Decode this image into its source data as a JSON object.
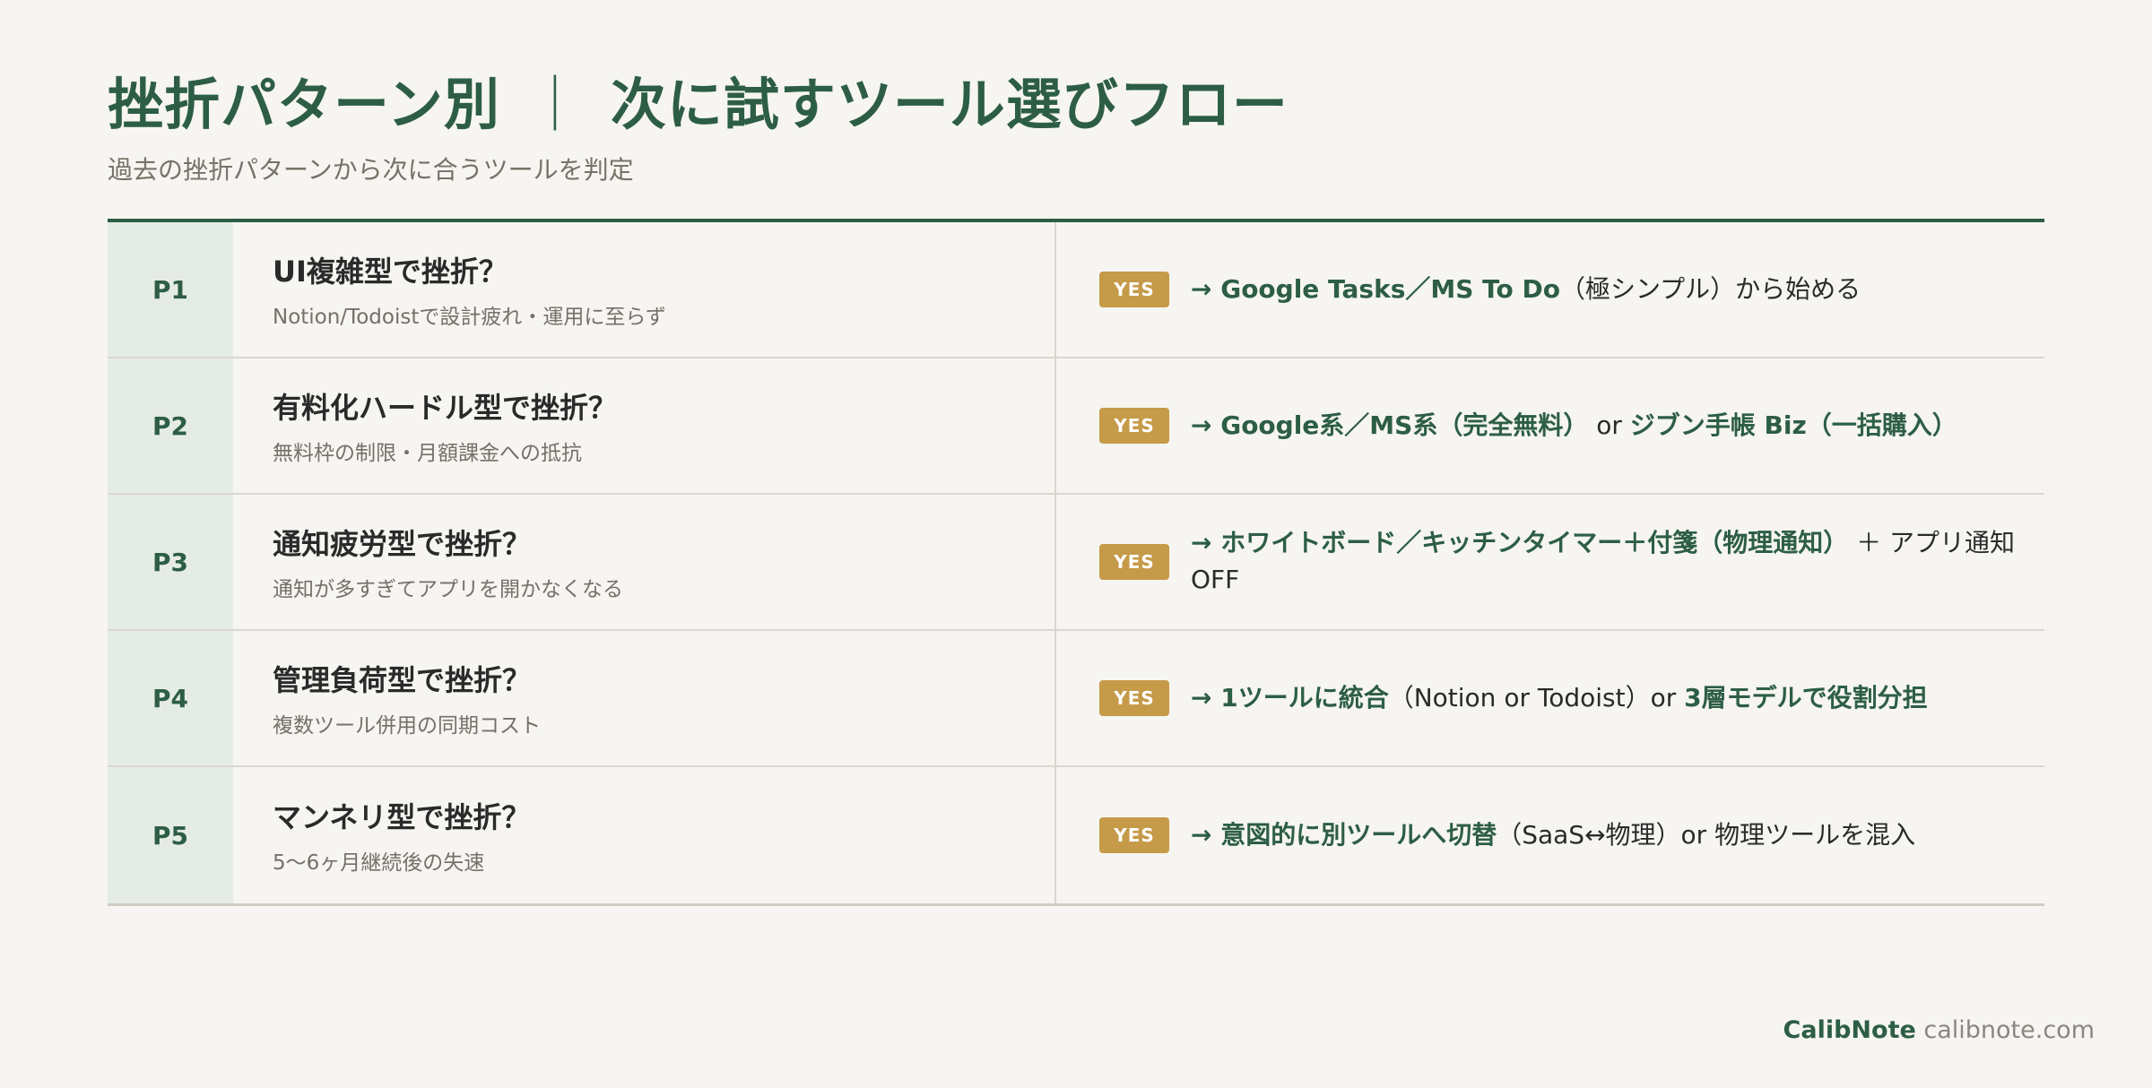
{
  "header": {
    "title_left": "挫折パターン別",
    "title_separator": "｜",
    "title_right": "次に試すツール選びフロー",
    "subtitle": "過去の挫折パターンから次に合うツールを判定"
  },
  "badge_label": "YES",
  "rows": [
    {
      "code": "P1",
      "question": "UI複雑型で挫折？",
      "detail": "Notion/Todoistで設計疲れ・運用に至らず",
      "answer": [
        {
          "text": "→ Google Tasks／MS To Do",
          "em": true
        },
        {
          "text": "（極シンプル）から始める",
          "em": false
        }
      ]
    },
    {
      "code": "P2",
      "question": "有料化ハードル型で挫折？",
      "detail": "無料枠の制限・月額課金への抵抗",
      "answer": [
        {
          "text": "→ Google系／MS系（完全無料）",
          "em": true
        },
        {
          "text": " or ",
          "em": false
        },
        {
          "text": "ジブン手帳 Biz（一括購入）",
          "em": true
        }
      ]
    },
    {
      "code": "P3",
      "question": "通知疲労型で挫折？",
      "detail": "通知が多すぎてアプリを開かなくなる",
      "answer": [
        {
          "text": "→ ホワイトボード／キッチンタイマー＋付箋（物理通知）",
          "em": true
        },
        {
          "text": " ＋ アプリ通知OFF",
          "em": false
        }
      ]
    },
    {
      "code": "P4",
      "question": "管理負荷型で挫折？",
      "detail": "複数ツール併用の同期コスト",
      "answer": [
        {
          "text": "→ 1ツールに統合",
          "em": true
        },
        {
          "text": "（Notion or Todoist）or ",
          "em": false
        },
        {
          "text": "3層モデルで役割分担",
          "em": true
        }
      ]
    },
    {
      "code": "P5",
      "question": "マンネリ型で挫折？",
      "detail": "5〜6ヶ月継続後の失速",
      "answer": [
        {
          "text": "→ 意図的に別ツールへ切替",
          "em": true
        },
        {
          "text": "（SaaS↔物理）or 物理ツールを混入",
          "em": false
        }
      ]
    }
  ],
  "footer": {
    "brand": "CalibNote",
    "url": "calibnote.com"
  },
  "colors": {
    "background": "#f6f5f1",
    "accent_green": "#2d5e45",
    "badge_gold": "#c59a48",
    "code_cell_bg": "#e5ece6"
  }
}
